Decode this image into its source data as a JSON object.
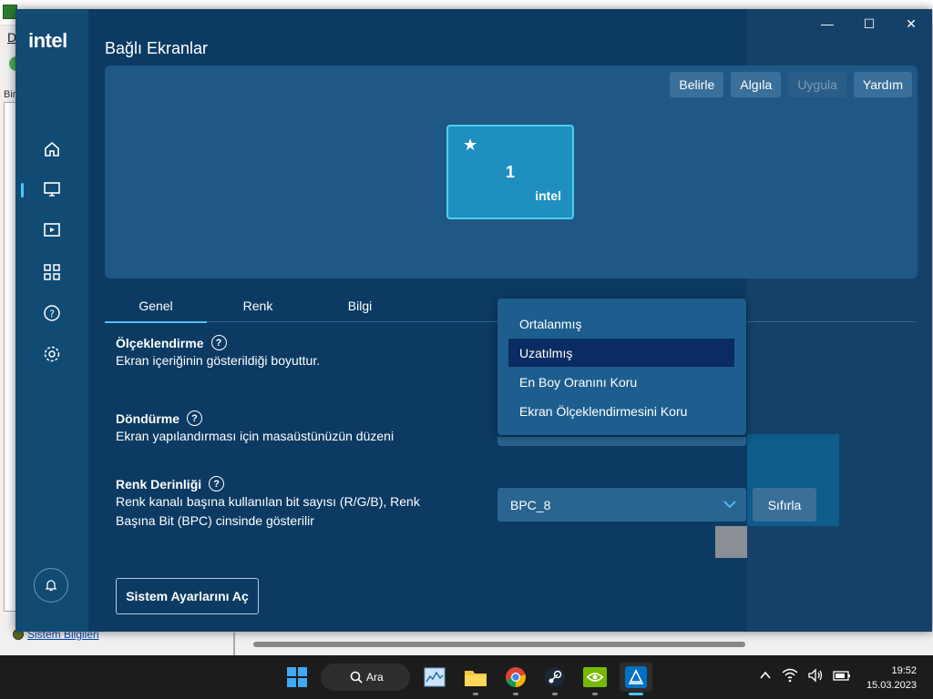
{
  "background_app": {
    "menu_char": "D",
    "left_label": "Bir",
    "bottom_link": "Sistem Bilgileri"
  },
  "window": {
    "logo": "intel",
    "title": "Bağlı Ekranlar",
    "controls": {
      "minimize": "—",
      "maximize": "☐",
      "close": "✕"
    }
  },
  "nav": {
    "items": [
      {
        "name": "home",
        "icon": "home-icon"
      },
      {
        "name": "display",
        "icon": "monitor-icon",
        "active": true
      },
      {
        "name": "video",
        "icon": "video-icon"
      },
      {
        "name": "apps",
        "icon": "grid-icon"
      },
      {
        "name": "help",
        "icon": "help-icon"
      },
      {
        "name": "settings",
        "icon": "gear-icon"
      }
    ],
    "notification_icon": "bell-icon"
  },
  "display_panel": {
    "buttons": [
      {
        "label": "Belirle",
        "enabled": true
      },
      {
        "label": "Algıla",
        "enabled": true
      },
      {
        "label": "Uygula",
        "enabled": false
      },
      {
        "label": "Yardım",
        "enabled": true
      }
    ],
    "monitor": {
      "star": "★",
      "number": "1",
      "brand": "intel"
    }
  },
  "tabs": [
    {
      "label": "Genel",
      "active": true
    },
    {
      "label": "Renk",
      "active": false
    },
    {
      "label": "Bilgi",
      "active": false
    }
  ],
  "sections": {
    "scaling": {
      "title": "Ölçeklendirme",
      "description": "Ekran içeriğinin gösterildiği boyuttur."
    },
    "rotation": {
      "title": "Döndürme",
      "description": "Ekran yapılandırması için masaüstünüzün düzeni"
    },
    "color_depth": {
      "title": "Renk Derinliği",
      "description_line1": "Renk kanalı başına kullanılan bit sayısı (R/G/B), Renk",
      "description_line2": "Başına Bit (BPC) cinsinde gösterilir",
      "value": "BPC_8",
      "reset_label": "Sıfırla"
    }
  },
  "scaling_dropdown": {
    "options": [
      "Ortalanmış",
      "Uzatılmış",
      "En Boy Oranını Koru",
      "Ekran Ölçeklendirmesini Koru"
    ],
    "selected": "Uzatılmış"
  },
  "help_glyph": "?",
  "system_settings_button": "Sistem Ayarlarını Aç",
  "taskbar": {
    "search_label": "Ara",
    "apps": [
      "start-icon",
      "search-icon",
      "task-manager-icon",
      "file-explorer-icon",
      "chrome-icon",
      "steam-icon",
      "nvidia-icon",
      "intel-graphics-icon"
    ],
    "time": "19:52",
    "date": "15.03.2023"
  },
  "colors": {
    "window_bg": "#0c3a63",
    "accent": "#4fc3f7",
    "selected_item": "#0b2b63"
  }
}
